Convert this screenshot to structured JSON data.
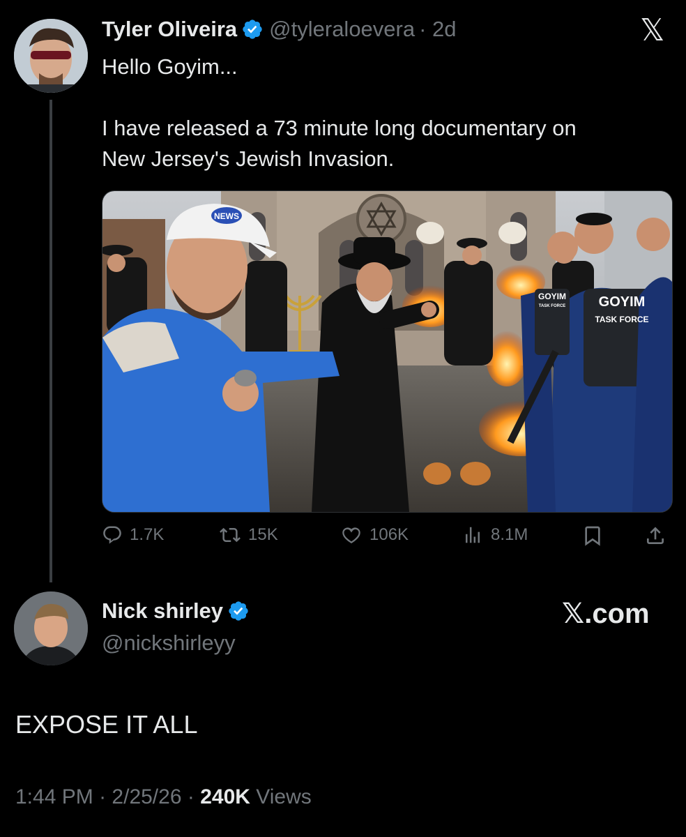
{
  "quoted_tweet": {
    "author_name": "Tyler Oliveira",
    "handle": "@tyleraloevera",
    "age": "· 2d",
    "text": "Hello Goyim...\n\nI have released a 73 minute long documentary on\nNew Jersey's Jewish Invasion.",
    "media": {
      "cap_badge": "NEWS",
      "vest_left_line1": "GOYIM",
      "vest_left_line2": "TASK FORCE",
      "vest_right_line1": "GOYIM",
      "vest_right_line2": "TASK FORCE"
    },
    "stats": {
      "replies": "1.7K",
      "reposts": "15K",
      "likes": "106K",
      "views": "8.1M"
    },
    "x_logo": "𝕏"
  },
  "main_tweet": {
    "author_name": "Nick shirley",
    "handle": "@nickshirleyy",
    "brand": "𝕏.com",
    "text": "EXPOSE IT ALL",
    "time": "1:44 PM",
    "sep1": "·",
    "date": "2/25/26",
    "sep2": "·",
    "view_count": "240K",
    "views_label": "Views"
  },
  "colors": {
    "background": "#000000",
    "text": "#e7e9ea",
    "secondary": "#71767b",
    "verified": "#1d9bf0"
  },
  "icons": [
    "verified-badge-icon",
    "reply-icon",
    "repost-icon",
    "like-icon",
    "views-icon",
    "bookmark-icon",
    "share-icon",
    "x-logo-icon"
  ]
}
